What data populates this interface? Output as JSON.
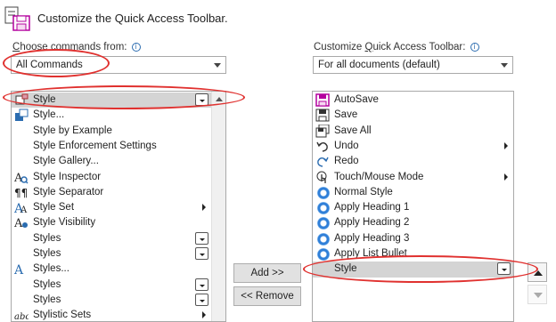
{
  "dialog": {
    "title": "Customize the Quick Access Toolbar."
  },
  "left": {
    "label_pre": "",
    "label_ul": "C",
    "label_post": "hoose commands from:",
    "combo_value": "All Commands",
    "items": [
      {
        "label": "Style",
        "icon": "style-paint-icon",
        "extra": "mini",
        "selected": true
      },
      {
        "label": "Style...",
        "icon": "style-dialog-icon",
        "extra": ""
      },
      {
        "label": "Style by Example",
        "icon": "",
        "extra": ""
      },
      {
        "label": "Style Enforcement Settings",
        "icon": "",
        "extra": ""
      },
      {
        "label": "Style Gallery...",
        "icon": "",
        "extra": ""
      },
      {
        "label": "Style Inspector",
        "icon": "style-inspector-icon",
        "extra": ""
      },
      {
        "label": "Style Separator",
        "icon": "pilcrow-icon",
        "extra": ""
      },
      {
        "label": "Style Set",
        "icon": "style-set-icon",
        "extra": "sub"
      },
      {
        "label": "Style Visibility",
        "icon": "style-visibility-icon",
        "extra": ""
      },
      {
        "label": "Styles",
        "icon": "",
        "extra": "mini"
      },
      {
        "label": "Styles",
        "icon": "",
        "extra": "mini"
      },
      {
        "label": "Styles...",
        "icon": "styles-dialog-icon",
        "extra": ""
      },
      {
        "label": "Styles",
        "icon": "",
        "extra": "mini"
      },
      {
        "label": "Styles",
        "icon": "",
        "extra": "mini"
      },
      {
        "label": "Stylistic Sets",
        "icon": "abc-icon",
        "extra": "sub"
      }
    ]
  },
  "buttons": {
    "add": "Add >>",
    "remove": "<< Remove"
  },
  "right": {
    "label_pre": "Customize ",
    "label_ul": "Q",
    "label_post": "uick Access Toolbar:",
    "combo_value": "For all documents (default)",
    "items": [
      {
        "label": "AutoSave",
        "icon": "autosave-icon",
        "extra": ""
      },
      {
        "label": "Save",
        "icon": "save-icon",
        "extra": ""
      },
      {
        "label": "Save All",
        "icon": "save-all-icon",
        "extra": ""
      },
      {
        "label": "Undo",
        "icon": "undo-icon",
        "extra": "sub"
      },
      {
        "label": "Redo",
        "icon": "redo-icon",
        "extra": ""
      },
      {
        "label": "Touch/Mouse Mode",
        "icon": "touch-mode-icon",
        "extra": "sub"
      },
      {
        "label": "Normal Style",
        "icon": "circle-icon",
        "extra": ""
      },
      {
        "label": "Apply Heading 1",
        "icon": "circle-icon",
        "extra": ""
      },
      {
        "label": "Apply Heading 2",
        "icon": "circle-icon",
        "extra": ""
      },
      {
        "label": "Apply Heading 3",
        "icon": "circle-icon",
        "extra": ""
      },
      {
        "label": "Apply List Bullet",
        "icon": "circle-icon",
        "extra": ""
      },
      {
        "label": "Style",
        "icon": "",
        "extra": "mini",
        "selected": true
      }
    ]
  },
  "colors": {
    "accent": "#e0312f",
    "selection": "#d4d4d4",
    "autosave": "#b4009e"
  }
}
